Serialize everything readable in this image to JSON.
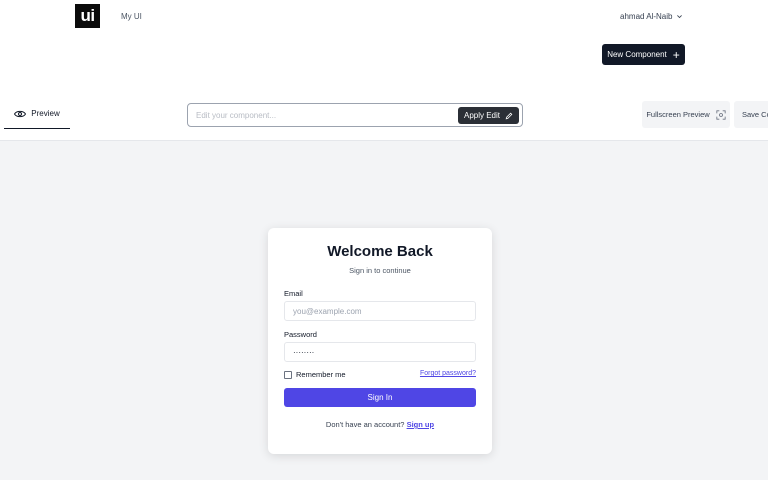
{
  "header": {
    "logo_text": "ui",
    "nav_link": "My UI",
    "user_name": "ahmad Al-Naib",
    "new_component_label": "New Component"
  },
  "toolbar": {
    "preview_tab": "Preview",
    "edit_placeholder": "Edit your component...",
    "apply_edit_label": "Apply Edit",
    "fullscreen_label": "Fullscreen Preview",
    "save_label": "Save Co"
  },
  "login_card": {
    "title": "Welcome Back",
    "subtitle": "Sign in to continue",
    "email_label": "Email",
    "email_placeholder": "you@example.com",
    "password_label": "Password",
    "password_value": "········",
    "remember_label": "Remember me",
    "forgot_label": "Forgot password?",
    "signin_label": "Sign In",
    "no_account_text": "Don't have an account?",
    "signup_label": "Sign up"
  },
  "colors": {
    "primary": "#4f46e5",
    "dark": "#111827",
    "canvas_bg": "#f3f4f6"
  },
  "icons": {
    "preview": "eye-icon",
    "apply": "pencil-icon",
    "fullscreen": "scan-icon",
    "new": "plus-icon",
    "user_menu": "chevron-down-icon"
  }
}
